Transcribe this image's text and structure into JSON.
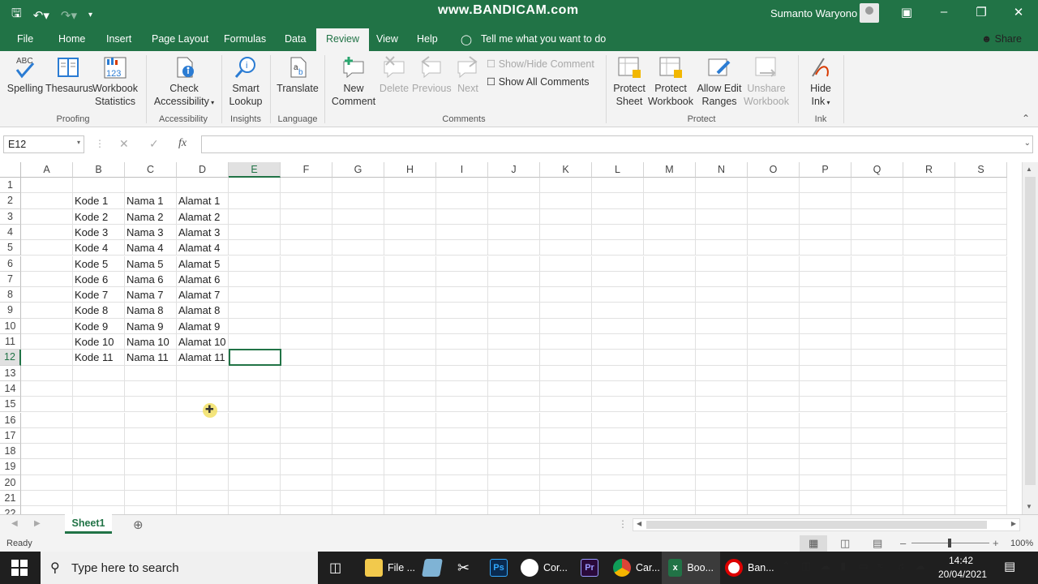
{
  "titlebar": {
    "watermark": "www.BANDICAM.com",
    "user": "Sumanto Waryono"
  },
  "tabs": [
    "File",
    "Home",
    "Insert",
    "Page Layout",
    "Formulas",
    "Data",
    "Review",
    "View",
    "Help"
  ],
  "tell_me": "Tell me what you want to do",
  "share": "Share",
  "ribbon": {
    "spelling": "Spelling",
    "thesaurus": "Thesaurus",
    "wb_stats_1": "Workbook",
    "wb_stats_2": "Statistics",
    "proofing": "Proofing",
    "check_acc_1": "Check",
    "check_acc_2": "Accessibility",
    "accessibility": "Accessibility",
    "smart_1": "Smart",
    "smart_2": "Lookup",
    "insights": "Insights",
    "translate": "Translate",
    "language": "Language",
    "new_comment_1": "New",
    "new_comment_2": "Comment",
    "delete": "Delete",
    "previous": "Previous",
    "next": "Next",
    "show_hide": "Show/Hide Comment",
    "show_all": "Show All Comments",
    "comments": "Comments",
    "protect_sheet_1": "Protect",
    "protect_sheet_2": "Sheet",
    "protect_wb_1": "Protect",
    "protect_wb_2": "Workbook",
    "allow_edit_1": "Allow Edit",
    "allow_edit_2": "Ranges",
    "unshare_1": "Unshare",
    "unshare_2": "Workbook",
    "protect": "Protect",
    "hide_ink_1": "Hide",
    "hide_ink_2": "Ink",
    "ink": "Ink"
  },
  "namebox": "E12",
  "fx": "fx",
  "columns": [
    "A",
    "B",
    "C",
    "D",
    "E",
    "F",
    "G",
    "H",
    "I",
    "J",
    "K",
    "L",
    "M",
    "N",
    "O",
    "P",
    "Q",
    "R",
    "S"
  ],
  "rows": [
    "1",
    "2",
    "3",
    "4",
    "5",
    "6",
    "7",
    "8",
    "9",
    "10",
    "11",
    "12",
    "13",
    "14",
    "15",
    "16",
    "17",
    "18",
    "19",
    "20",
    "21",
    "22"
  ],
  "cells": [
    [
      "Kode 1",
      "Nama 1",
      "Alamat 1"
    ],
    [
      "Kode 2",
      "Nama 2",
      "Alamat 2"
    ],
    [
      "Kode 3",
      "Nama 3",
      "Alamat 3"
    ],
    [
      "Kode 4",
      "Nama 4",
      "Alamat 4"
    ],
    [
      "Kode 5",
      "Nama 5",
      "Alamat 5"
    ],
    [
      "Kode 6",
      "Nama 6",
      "Alamat 6"
    ],
    [
      "Kode 7",
      "Nama 7",
      "Alamat 7"
    ],
    [
      "Kode 8",
      "Nama 8",
      "Alamat 8"
    ],
    [
      "Kode 9",
      "Nama 9",
      "Alamat 9"
    ],
    [
      "Kode 10",
      "Nama 10",
      "Alamat 10"
    ],
    [
      "Kode 11",
      "Nama 11",
      "Alamat 11"
    ]
  ],
  "sheet_tab": "Sheet1",
  "status": {
    "ready": "Ready",
    "zoom": "100%"
  },
  "taskbar": {
    "search": "Type here to search",
    "apps": [
      "File ...",
      "Cor...",
      "Car...",
      "Boo...",
      "Ban..."
    ],
    "time": "14:42",
    "date": "20/04/2021"
  },
  "colors": {
    "excel_green": "#217346"
  }
}
